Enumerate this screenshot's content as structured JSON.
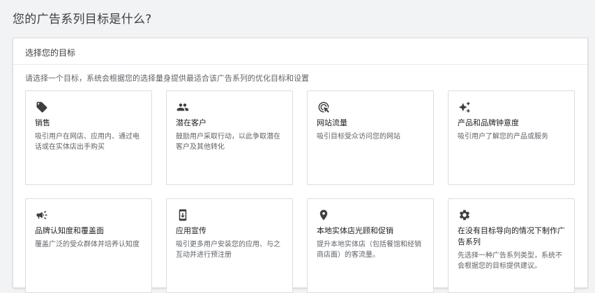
{
  "page": {
    "title": "您的广告系列目标是什么?"
  },
  "panel": {
    "header": "选择您的目标",
    "subtitle": "请选择一个目标，系统会根据您的选择量身提供最适合该广告系列的优化目标和设置"
  },
  "goals": [
    {
      "icon": "tag-icon",
      "title": "销售",
      "desc": "吸引用户在网店、应用内、通过电话或在实体店出手购买"
    },
    {
      "icon": "people-icon",
      "title": "潜在客户",
      "desc": "鼓励用户采取行动，以此争取潜在客户及其他转化"
    },
    {
      "icon": "click-icon",
      "title": "网站流量",
      "desc": "吸引目标受众访问您的网站"
    },
    {
      "icon": "sparkle-icon",
      "title": "产品和品牌钟意度",
      "desc": "吸引用户了解您的产品或服务"
    },
    {
      "icon": "megaphone-icon",
      "title": "品牌认知度和覆盖面",
      "desc": "覆盖广泛的受众群体并培养认知度"
    },
    {
      "icon": "phone-download-icon",
      "title": "应用宣传",
      "desc": "吸引更多用户安装您的应用、与之互动并进行预注册"
    },
    {
      "icon": "location-pin-icon",
      "title": "本地实体店光顾和促销",
      "desc": "提升本地实体店（包括餐馆和经销商店面）的客流量。"
    },
    {
      "icon": "gear-icon",
      "title": "在没有目标导向的情况下制作广告系列",
      "desc": "先选择一种广告系列类型，系统不会根据您的目标提供建议。"
    }
  ]
}
